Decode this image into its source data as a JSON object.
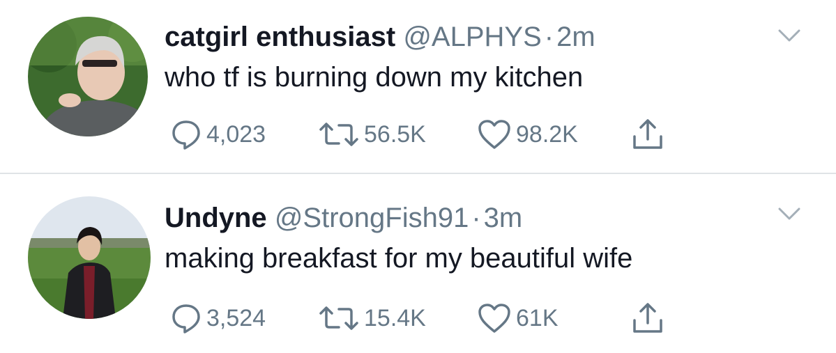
{
  "colors": {
    "text": "#141823",
    "secondary": "#657786",
    "divider": "#dfe3e6"
  },
  "tweets": [
    {
      "display_name": "catgirl enthusiast",
      "handle": "@ALPHYS",
      "separator": "·",
      "time": "2m",
      "text": "who tf is burning down my kitchen",
      "replies": "4,023",
      "retweets": "56.5K",
      "likes": "98.2K",
      "icons": [
        "reply-icon",
        "retweet-icon",
        "like-icon",
        "share-icon",
        "chevron-down-icon"
      ]
    },
    {
      "display_name": "Undyne",
      "handle": "@StrongFish91",
      "separator": "·",
      "time": "3m",
      "text": "making breakfast for my beautiful wife",
      "replies": "3,524",
      "retweets": "15.4K",
      "likes": "61K",
      "icons": [
        "reply-icon",
        "retweet-icon",
        "like-icon",
        "share-icon",
        "chevron-down-icon"
      ]
    }
  ]
}
